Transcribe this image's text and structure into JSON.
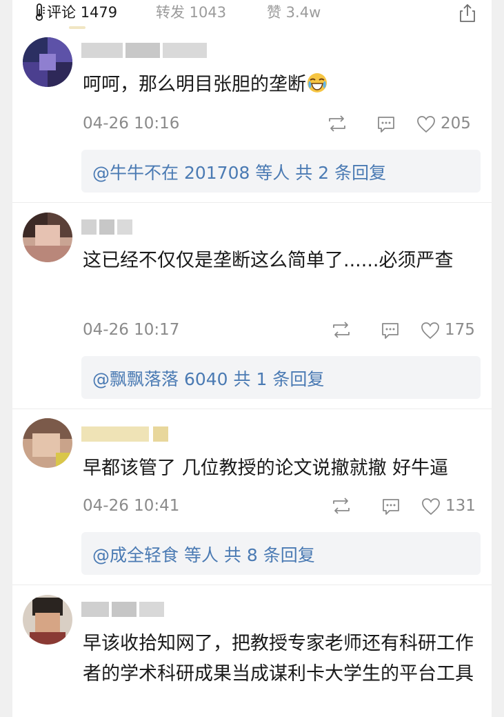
{
  "tabs": {
    "comments_label": "评论",
    "comments_count": "1479",
    "reposts": "转发 1043",
    "likes": "赞 3.4w"
  },
  "icons": {
    "thermometer": "thermometer-icon",
    "share": "share-icon",
    "repost": "repost-icon",
    "comment": "comment-icon",
    "like": "heart-icon"
  },
  "colors": {
    "link": "#4a7ab3",
    "meta": "#8a8a8a",
    "reply_bg": "#f3f4f6"
  },
  "comments": [
    {
      "text": "呵呵，那么明目张胆的垄断",
      "time": "04-26 10:16",
      "likes": "205",
      "reply": "@牛牛不在 201708 等人  共 2 条回复"
    },
    {
      "text": "这已经不仅仅是垄断这么简单了......必须严查",
      "time": "04-26 10:17",
      "likes": "175",
      "reply": "@飘飘落落 6040  共 1 条回复"
    },
    {
      "text": "早都该管了 几位教授的论文说撤就撤 好牛逼",
      "time": "04-26 10:41",
      "likes": "131",
      "reply": "@成全轻食 等人  共 8 条回复"
    },
    {
      "text": "早该收拾知网了，把教授专家老师还有科研工作者的学术科研成果当成谋利卡大学生的平台工具"
    }
  ]
}
